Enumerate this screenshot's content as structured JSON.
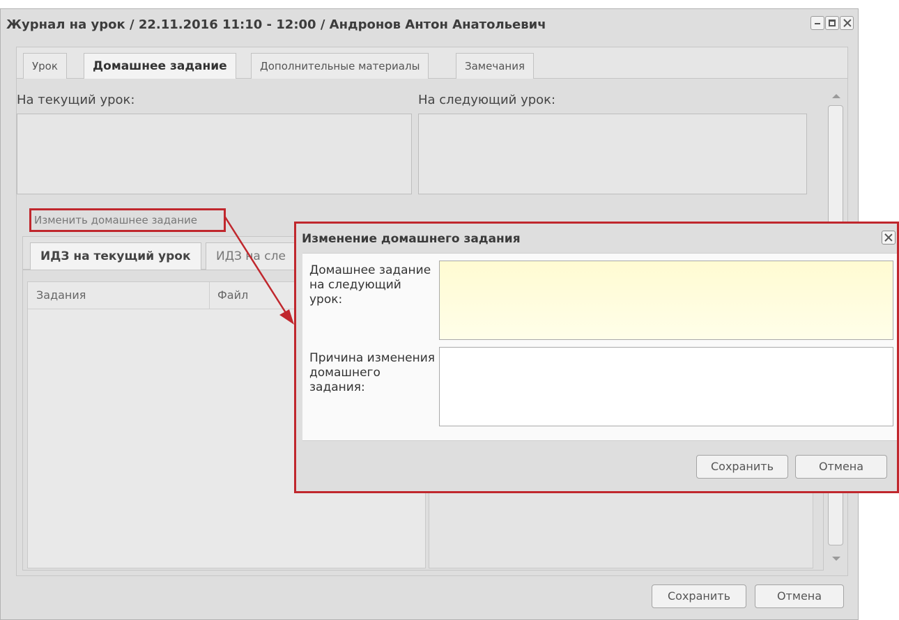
{
  "window": {
    "title": "Журнал на урок / 22.11.2016 11:10 - 12:00 / Андронов Антон Анатольевич"
  },
  "tabs": [
    {
      "label": "Урок"
    },
    {
      "label": "Домашнее задание"
    },
    {
      "label": "Дополнительные материалы"
    },
    {
      "label": "Замечания"
    }
  ],
  "homework": {
    "current_label": "На текущий урок:",
    "next_label": "На следующий урок:",
    "change_button": "Изменить домашнее задание"
  },
  "subtabs": [
    {
      "label": "ИДЗ на текущий урок"
    },
    {
      "label": "ИДЗ на сле"
    }
  ],
  "grid": {
    "columns": [
      "Задания",
      "Файл"
    ]
  },
  "footer": {
    "save": "Сохранить",
    "cancel": "Отмена"
  },
  "dialog": {
    "title": "Изменение домашнего задания",
    "field1_label": "Домашнее задание на следующий урок:",
    "field2_label": "Причина изменения домашнего задания:",
    "save": "Сохранить",
    "cancel": "Отмена"
  },
  "colors": {
    "highlight": "#c0272d",
    "window_bg": "#dedede"
  }
}
